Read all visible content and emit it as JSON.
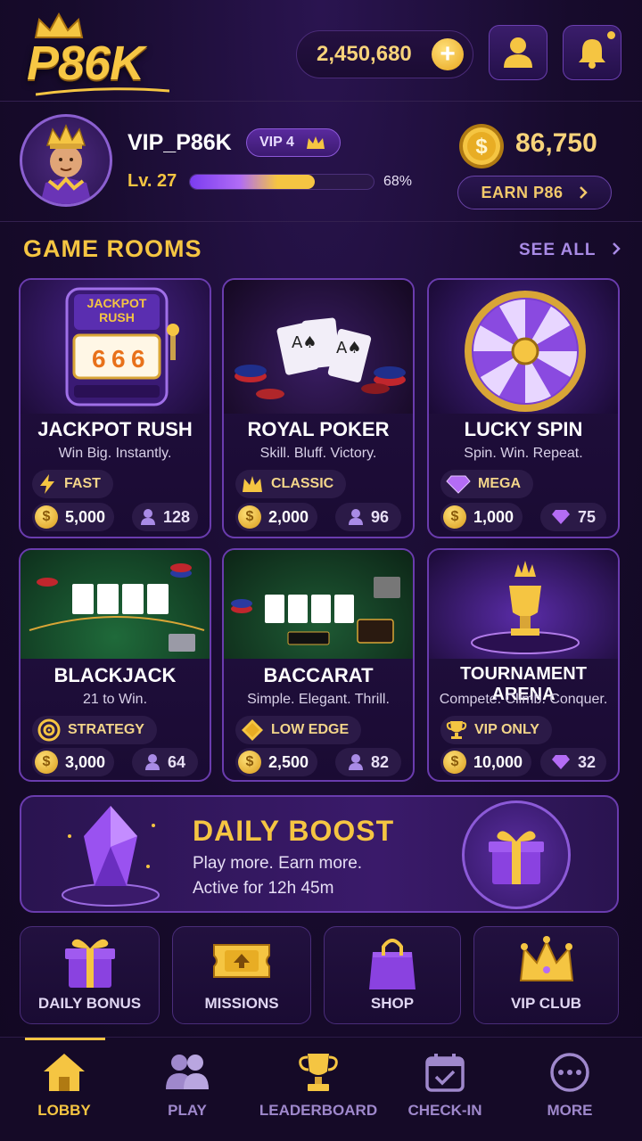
{
  "header": {
    "logo_text": "P86K",
    "balance": "2,450,680"
  },
  "profile": {
    "username": "VIP_P86K",
    "vip": "VIP 4",
    "level": "Lv. 27",
    "xp_percent": 68,
    "xp_label": "68%",
    "coins": "86,750",
    "earn_label": "EARN P86"
  },
  "game_rooms": {
    "title": "GAME ROOMS",
    "see_all": "SEE ALL",
    "rooms": [
      {
        "title": "JACKPOT RUSH",
        "subtitle": "Win Big. Instantly.",
        "tag": "FAST",
        "tag_icon": "lightning-icon",
        "cost": "5,000",
        "players": "128",
        "player_icon": "user-icon",
        "art_text": "JACKPOT RUSH"
      },
      {
        "title": "ROYAL POKER",
        "subtitle": "Skill. Bluff. Victory.",
        "tag": "CLASSIC",
        "tag_icon": "crown-icon",
        "cost": "2,000",
        "players": "96",
        "player_icon": "user-icon"
      },
      {
        "title": "LUCKY SPIN",
        "subtitle": "Spin. Win. Repeat.",
        "tag": "MEGA",
        "tag_icon": "diamond-icon",
        "cost": "1,000",
        "players": "75",
        "player_icon": "diamond-icon"
      },
      {
        "title": "BLACKJACK",
        "subtitle": "21 to Win.",
        "tag": "STRATEGY",
        "tag_icon": "target-icon",
        "cost": "3,000",
        "players": "64",
        "player_icon": "user-icon"
      },
      {
        "title": "BACCARAT",
        "subtitle": "Simple. Elegant. Thrill.",
        "tag": "LOW EDGE",
        "tag_icon": "gem-icon",
        "cost": "2,500",
        "players": "82",
        "player_icon": "user-icon"
      },
      {
        "title": "TOURNAMENT ARENA",
        "subtitle": "Compete. Climb. Conquer.",
        "tag": "VIP ONLY",
        "tag_icon": "trophy-icon",
        "cost": "10,000",
        "players": "32",
        "player_icon": "diamond-icon"
      }
    ]
  },
  "daily_boost": {
    "title": "DAILY BOOST",
    "line1": "Play more. Earn more.",
    "line2": "Active for 12h 45m"
  },
  "quick_actions": [
    {
      "label": "DAILY BONUS",
      "icon": "gift-icon"
    },
    {
      "label": "MISSIONS",
      "icon": "ticket-icon"
    },
    {
      "label": "SHOP",
      "icon": "shopping-bag-icon"
    },
    {
      "label": "VIP CLUB",
      "icon": "crown-icon"
    }
  ],
  "nav": [
    {
      "label": "LOBBY",
      "icon": "home-icon",
      "active": true
    },
    {
      "label": "PLAY",
      "icon": "users-icon"
    },
    {
      "label": "LEADERBOARD",
      "icon": "trophy-icon"
    },
    {
      "label": "CHECK-IN",
      "icon": "calendar-check-icon"
    },
    {
      "label": "MORE",
      "icon": "more-icon"
    }
  ],
  "colors": {
    "background": "#170b2c",
    "gold": "#f5c542",
    "purple_accent": "#6a3cae"
  }
}
